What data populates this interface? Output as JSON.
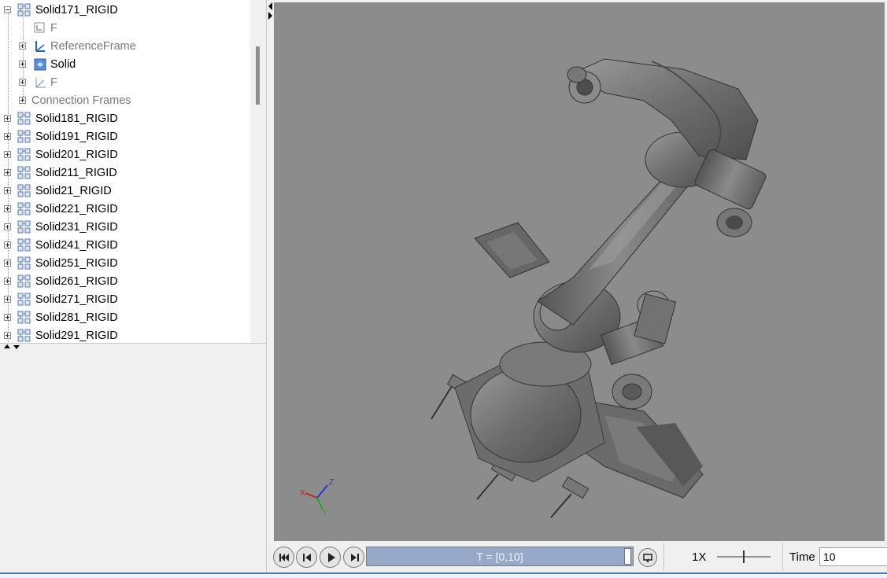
{
  "tree": {
    "items": [
      {
        "label": "Solid171_RIGID",
        "icon": "rigid-body-icon",
        "indent": 0,
        "expander": "minus",
        "grey": false
      },
      {
        "label": "F",
        "icon": "frame-port-icon",
        "indent": 2,
        "expander": "none",
        "grey": true
      },
      {
        "label": "ReferenceFrame",
        "icon": "reference-frame-icon",
        "indent": 2,
        "expander": "plus",
        "grey": true
      },
      {
        "label": "Solid",
        "icon": "solid-icon",
        "indent": 2,
        "expander": "plus",
        "grey": false
      },
      {
        "label": "F",
        "icon": "frame-icon",
        "indent": 2,
        "expander": "plus",
        "grey": true
      },
      {
        "label": "Connection Frames",
        "icon": "",
        "indent": 1,
        "expander": "plus",
        "grey": true
      },
      {
        "label": "Solid181_RIGID",
        "icon": "rigid-body-icon",
        "indent": 0,
        "expander": "plus",
        "grey": false
      },
      {
        "label": "Solid191_RIGID",
        "icon": "rigid-body-icon",
        "indent": 0,
        "expander": "plus",
        "grey": false
      },
      {
        "label": "Solid201_RIGID",
        "icon": "rigid-body-icon",
        "indent": 0,
        "expander": "plus",
        "grey": false
      },
      {
        "label": "Solid211_RIGID",
        "icon": "rigid-body-icon",
        "indent": 0,
        "expander": "plus",
        "grey": false
      },
      {
        "label": "Solid21_RIGID",
        "icon": "rigid-body-icon",
        "indent": 0,
        "expander": "plus",
        "grey": false
      },
      {
        "label": "Solid221_RIGID",
        "icon": "rigid-body-icon",
        "indent": 0,
        "expander": "plus",
        "grey": false
      },
      {
        "label": "Solid231_RIGID",
        "icon": "rigid-body-icon",
        "indent": 0,
        "expander": "plus",
        "grey": false
      },
      {
        "label": "Solid241_RIGID",
        "icon": "rigid-body-icon",
        "indent": 0,
        "expander": "plus",
        "grey": false
      },
      {
        "label": "Solid251_RIGID",
        "icon": "rigid-body-icon",
        "indent": 0,
        "expander": "plus",
        "grey": false
      },
      {
        "label": "Solid261_RIGID",
        "icon": "rigid-body-icon",
        "indent": 0,
        "expander": "plus",
        "grey": false
      },
      {
        "label": "Solid271_RIGID",
        "icon": "rigid-body-icon",
        "indent": 0,
        "expander": "plus",
        "grey": false
      },
      {
        "label": "Solid281_RIGID",
        "icon": "rigid-body-icon",
        "indent": 0,
        "expander": "plus",
        "grey": false
      },
      {
        "label": "Solid291_RIGID",
        "icon": "rigid-body-icon",
        "indent": 0,
        "expander": "plus",
        "grey": false
      }
    ]
  },
  "viewport": {
    "axes": {
      "x": "X",
      "y": "Y",
      "z": "Z"
    },
    "background": "#8c8c8c"
  },
  "playback": {
    "buttons": [
      "skip-to-start-icon",
      "step-back-icon",
      "play-icon",
      "step-forward-icon"
    ],
    "timeline_label": "T = [0,10]",
    "loop_icon": "loop-icon",
    "speed": "1X",
    "time_label": "Time",
    "time_value": "10"
  },
  "colors": {
    "timeline": "#96a9c8",
    "accent": "#4a7ab5"
  }
}
